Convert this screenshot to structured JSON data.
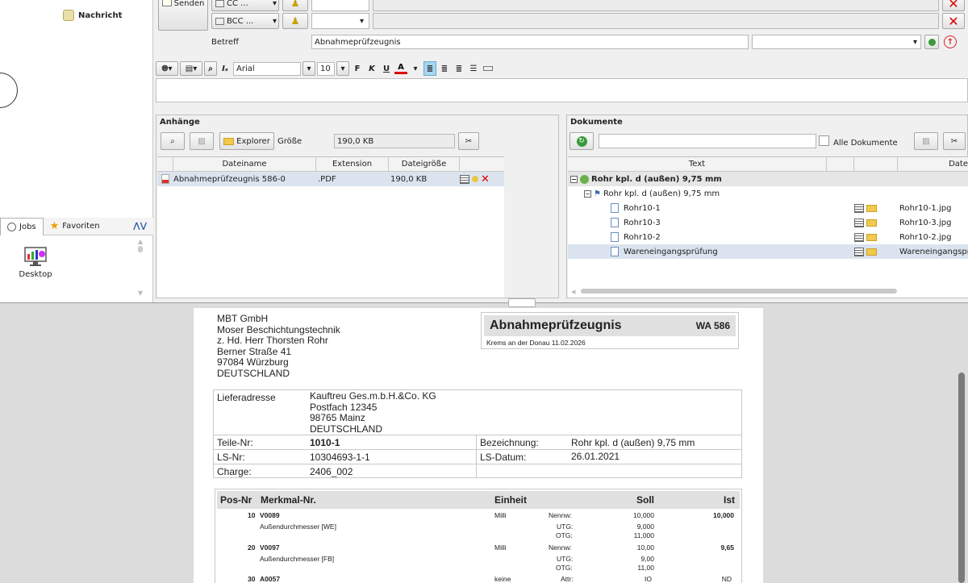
{
  "left": {
    "tree": [
      {
        "label": "Nachricht"
      }
    ],
    "tabs": [
      {
        "label": "Jobs"
      },
      {
        "label": "Favoriten"
      }
    ],
    "desktop_label": "Desktop"
  },
  "form": {
    "send_label": "Senden",
    "cc_label": "CC ...",
    "bcc_label": "BCC ...",
    "subject_label": "Betreff",
    "subject_value": "Abnahmeprüfzeugnis"
  },
  "editor": {
    "font": "Arial",
    "size": "10",
    "bold": "F",
    "italic": "K",
    "underline": "U",
    "color": "A"
  },
  "attachments": {
    "title": "Anhänge",
    "explorer_label": "Explorer",
    "size_label": "Größe",
    "size_value": "190,0 KB",
    "columns": [
      "Dateiname",
      "Extension",
      "Dateigröße"
    ],
    "rows": [
      {
        "name": "Abnahmeprüfzeugnis 586-0",
        "ext": ".PDF",
        "size": "190,0 KB"
      }
    ]
  },
  "documents": {
    "title": "Dokumente",
    "all_label": "Alle Dokumente",
    "columns": [
      "Text",
      "Date"
    ],
    "rows": [
      {
        "text": "Rohr kpl. d (außen) 9,75 mm",
        "file": ""
      },
      {
        "text": "Rohr kpl. d (außen) 9,75 mm",
        "file": ""
      },
      {
        "text": "Rohr10-1",
        "file": "Rohr10-1.jpg"
      },
      {
        "text": "Rohr10-3",
        "file": "Rohr10-3.jpg"
      },
      {
        "text": "Rohr10-2",
        "file": "Rohr10-2.jpg"
      },
      {
        "text": "Wareneingangsprüfung",
        "file": "Wareneingangspr"
      }
    ]
  },
  "pdf": {
    "address": [
      "MBT GmbH",
      "Moser Beschichtungstechnik",
      "z. Hd. Herr Thorsten Rohr",
      "Berner Straße 41",
      "97084 Würzburg",
      "DEUTSCHLAND"
    ],
    "doc_title": "Abnahmeprüfzeugnis",
    "doc_number": "WA 586",
    "place_date": "Krems an der Donau 11.02.2026",
    "delivery_label": "Lieferadresse",
    "delivery": [
      "Kauftreu Ges.m.b.H.&Co. KG",
      "Postfach 12345",
      "98765 Mainz",
      "DEUTSCHLAND"
    ],
    "teile_label": "Teile-Nr:",
    "teile_value": "1010-1",
    "bez_label": "Bezeichnung:",
    "bez_value": "Rohr kpl. d (außen) 9,75 mm",
    "ls_label": "LS-Nr:",
    "ls_value": "10304693-1-1",
    "lsd_label": "LS-Datum:",
    "lsd_value": "26.01.2021",
    "charge_label": "Charge:",
    "charge_value": "2406_002",
    "table_head": [
      "Pos-Nr",
      "Merkmal-Nr.",
      "Einheit",
      "Soll",
      "Ist"
    ],
    "items": [
      {
        "pos": "10",
        "code": "V0089",
        "desc": "Außendurchmesser [WE]",
        "unit": "Milli",
        "lines": [
          [
            "Nennw:",
            "10,000"
          ],
          [
            "UTG:",
            "9,000"
          ],
          [
            "OTG:",
            "11,000"
          ]
        ],
        "ist": "10,000"
      },
      {
        "pos": "20",
        "code": "V0097",
        "desc": "Außendurchmesser [FB]",
        "unit": "Milli",
        "lines": [
          [
            "Nennw:",
            "10,00"
          ],
          [
            "UTG:",
            "9,00"
          ],
          [
            "OTG:",
            "11,00"
          ]
        ],
        "ist": "9,65"
      },
      {
        "pos": "30",
        "code": "A0057",
        "desc": "",
        "unit": "keine",
        "lines": [
          [
            "Attr:",
            "IO"
          ]
        ],
        "ist": "ND"
      }
    ]
  }
}
